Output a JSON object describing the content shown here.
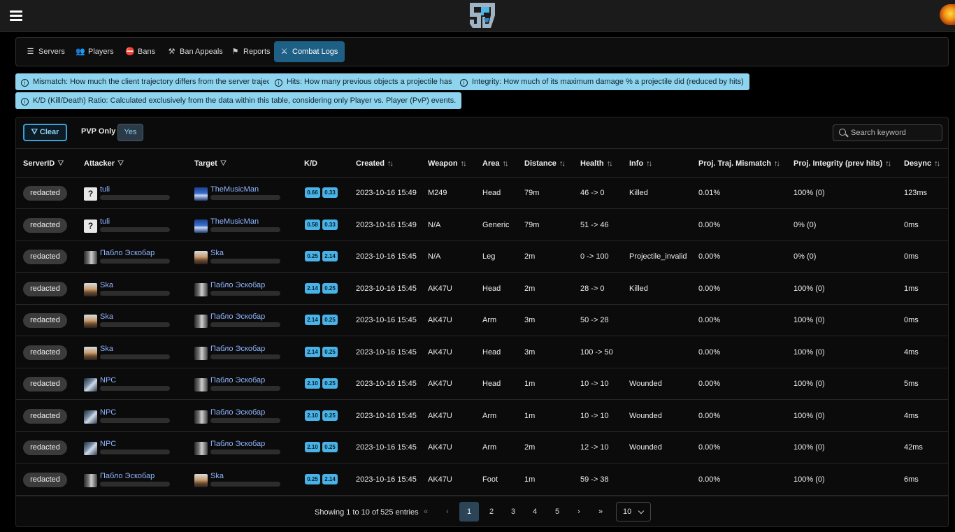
{
  "app": {
    "logo_text": "SA"
  },
  "nav": [
    {
      "label": "Servers",
      "icon": "server-icon"
    },
    {
      "label": "Players",
      "icon": "users-icon"
    },
    {
      "label": "Bans",
      "icon": "user-slash-icon"
    },
    {
      "label": "Ban Appeals",
      "icon": "gavel-icon"
    },
    {
      "label": "Reports",
      "icon": "flag-icon"
    },
    {
      "label": "Combat Logs",
      "icon": "combat-icon",
      "active": true
    }
  ],
  "info": {
    "mismatch": "Mismatch: How much the client trajectory differs from the server trajectory",
    "hits": "Hits: How many previous objects a projectile has hit",
    "integrity": "Integrity: How much of its maximum damage % a projectile did (reduced by hits)",
    "kd": "K/D (Kill/Death) Ratio: Calculated exclusively from the data within this table, considering only Player vs. Player (PvP) events."
  },
  "toolbar": {
    "clear_label": "Clear",
    "pvp_label": "PVP Only",
    "pvp_value": "Yes",
    "search_placeholder": "Search keyword"
  },
  "columns": {
    "server": "ServerID",
    "attacker": "Attacker",
    "target": "Target",
    "kd": "K/D",
    "created": "Created",
    "weapon": "Weapon",
    "area": "Area",
    "distance": "Distance",
    "health": "Health",
    "info": "Info",
    "mismatch": "Proj. Traj. Mismatch",
    "integrity": "Proj. Integrity (prev hits)",
    "desync": "Desync"
  },
  "rows": [
    {
      "server": "redacted",
      "attacker": {
        "name": "tuli",
        "avatar": "question"
      },
      "target": {
        "name": "TheMusicMan",
        "avatar": "tm"
      },
      "kd": [
        "0.66",
        "0.33"
      ],
      "created": "2023-10-16 15:49",
      "weapon": "M249",
      "area": "Head",
      "distance": "79m",
      "health": "46 -> 0",
      "info": "Killed",
      "mismatch": "0.01%",
      "integrity": "100% (0)",
      "desync": "123ms"
    },
    {
      "server": "redacted",
      "attacker": {
        "name": "tuli",
        "avatar": "question"
      },
      "target": {
        "name": "TheMusicMan",
        "avatar": "tm"
      },
      "kd": [
        "0.58",
        "0.33"
      ],
      "created": "2023-10-16 15:49",
      "weapon": "N/A",
      "area": "Generic",
      "distance": "79m",
      "health": "51 -> 46",
      "info": "",
      "mismatch": "0.00%",
      "integrity": "0% (0)",
      "desync": "0ms"
    },
    {
      "server": "redacted",
      "attacker": {
        "name": "Пабло Эскобар",
        "avatar": "pe"
      },
      "target": {
        "name": "Ska",
        "avatar": "ska"
      },
      "kd": [
        "0.25",
        "2.14"
      ],
      "created": "2023-10-16 15:45",
      "weapon": "N/A",
      "area": "Leg",
      "distance": "2m",
      "health": "0 -> 100",
      "info": "Projectile_invalid",
      "mismatch": "0.00%",
      "integrity": "0% (0)",
      "desync": "0ms"
    },
    {
      "server": "redacted",
      "attacker": {
        "name": "Ska",
        "avatar": "ska"
      },
      "target": {
        "name": "Пабло Эскобар",
        "avatar": "pe"
      },
      "kd": [
        "2.14",
        "0.25"
      ],
      "created": "2023-10-16 15:45",
      "weapon": "AK47U",
      "area": "Head",
      "distance": "2m",
      "health": "28 -> 0",
      "info": "Killed",
      "mismatch": "0.00%",
      "integrity": "100% (0)",
      "desync": "1ms"
    },
    {
      "server": "redacted",
      "attacker": {
        "name": "Ska",
        "avatar": "ska"
      },
      "target": {
        "name": "Пабло Эскобар",
        "avatar": "pe"
      },
      "kd": [
        "2.14",
        "0.25"
      ],
      "created": "2023-10-16 15:45",
      "weapon": "AK47U",
      "area": "Arm",
      "distance": "3m",
      "health": "50 -> 28",
      "info": "",
      "mismatch": "0.00%",
      "integrity": "100% (0)",
      "desync": "0ms"
    },
    {
      "server": "redacted",
      "attacker": {
        "name": "Ska",
        "avatar": "ska"
      },
      "target": {
        "name": "Пабло Эскобар",
        "avatar": "pe"
      },
      "kd": [
        "2.14",
        "0.25"
      ],
      "created": "2023-10-16 15:45",
      "weapon": "AK47U",
      "area": "Head",
      "distance": "3m",
      "health": "100 -> 50",
      "info": "",
      "mismatch": "0.00%",
      "integrity": "100% (0)",
      "desync": "4ms"
    },
    {
      "server": "redacted",
      "attacker": {
        "name": "NPC",
        "avatar": "npc"
      },
      "target": {
        "name": "Пабло Эскобар",
        "avatar": "pe"
      },
      "kd": [
        "2.10",
        "0.25"
      ],
      "created": "2023-10-16 15:45",
      "weapon": "AK47U",
      "area": "Head",
      "distance": "1m",
      "health": "10 -> 10",
      "info": "Wounded",
      "mismatch": "0.00%",
      "integrity": "100% (0)",
      "desync": "5ms"
    },
    {
      "server": "redacted",
      "attacker": {
        "name": "NPC",
        "avatar": "npc"
      },
      "target": {
        "name": "Пабло Эскобар",
        "avatar": "pe"
      },
      "kd": [
        "2.10",
        "0.25"
      ],
      "created": "2023-10-16 15:45",
      "weapon": "AK47U",
      "area": "Arm",
      "distance": "1m",
      "health": "10 -> 10",
      "info": "Wounded",
      "mismatch": "0.00%",
      "integrity": "100% (0)",
      "desync": "4ms"
    },
    {
      "server": "redacted",
      "attacker": {
        "name": "NPC",
        "avatar": "npc"
      },
      "target": {
        "name": "Пабло Эскобар",
        "avatar": "pe"
      },
      "kd": [
        "2.10",
        "0.25"
      ],
      "created": "2023-10-16 15:45",
      "weapon": "AK47U",
      "area": "Arm",
      "distance": "2m",
      "health": "12 -> 10",
      "info": "Wounded",
      "mismatch": "0.00%",
      "integrity": "100% (0)",
      "desync": "42ms"
    },
    {
      "server": "redacted",
      "attacker": {
        "name": "Пабло Эскобар",
        "avatar": "pe"
      },
      "target": {
        "name": "Ska",
        "avatar": "ska"
      },
      "kd": [
        "0.25",
        "2.14"
      ],
      "created": "2023-10-16 15:45",
      "weapon": "AK47U",
      "area": "Foot",
      "distance": "1m",
      "health": "59 -> 38",
      "info": "",
      "mismatch": "0.00%",
      "integrity": "100% (0)",
      "desync": "6ms"
    }
  ],
  "pagination": {
    "summary": "Showing 1 to 10 of 525 entries",
    "first": "«",
    "prev": "‹",
    "next": "›",
    "last": "»",
    "pages": [
      "1",
      "2",
      "3",
      "4",
      "5"
    ],
    "current": "1",
    "page_size": "10"
  },
  "colors": {
    "accent": "#1e5f86",
    "info_chip": "#8fd4ee",
    "kd_badge": "#49b3e8",
    "player_link": "#8fb5ff"
  }
}
